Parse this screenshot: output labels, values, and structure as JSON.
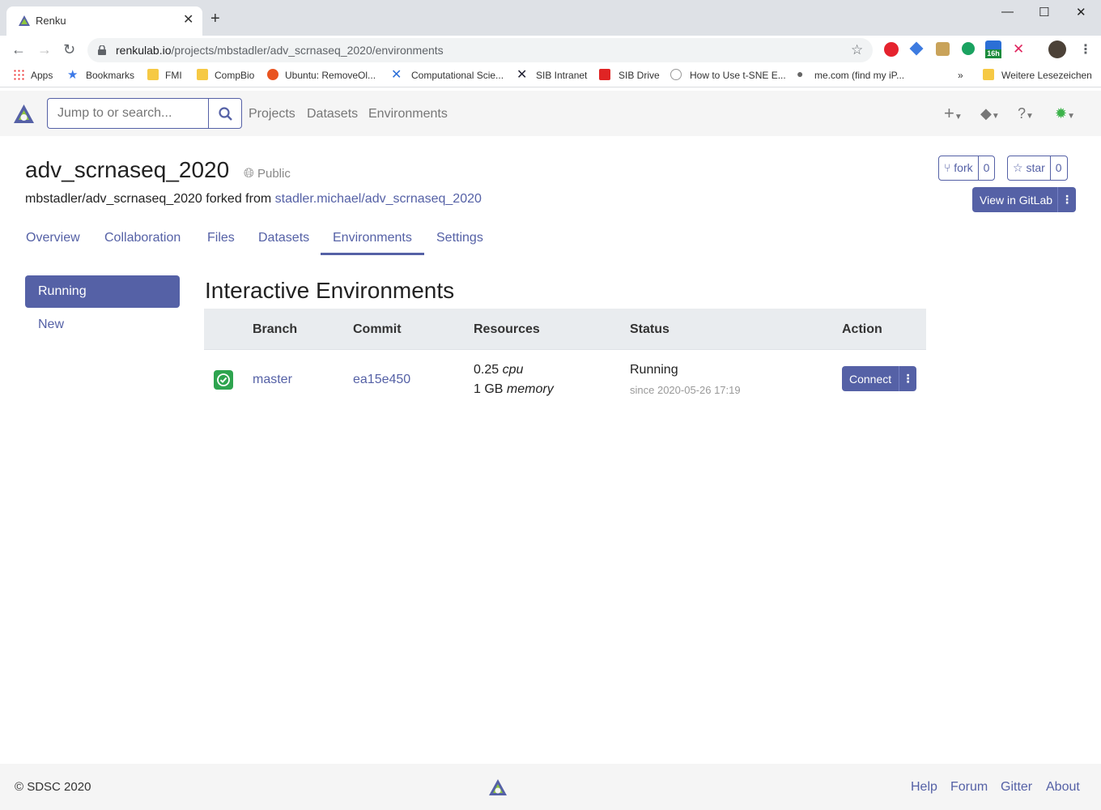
{
  "browser": {
    "tab_title": "Renku",
    "url_host": "renkulab.io",
    "url_path": "/projects/mbstadler/adv_scrnaseq_2020/environments",
    "bookmarks": [
      "Apps",
      "Bookmarks",
      "FMI",
      "CompBio",
      "Ubuntu: RemoveOl...",
      "Computational Scie...",
      "SIB Intranet",
      "SIB Drive",
      "How to Use t-SNE E...",
      "me.com (find my iP...",
      "»",
      "Weitere Lesezeichen"
    ],
    "ext_badge": "16h"
  },
  "app": {
    "search_placeholder": "Jump to or search...",
    "nav": [
      "Projects",
      "Datasets",
      "Environments"
    ],
    "accent": "#5561a6"
  },
  "project": {
    "title": "adv_scrnaseq_2020",
    "visibility": "Public",
    "fork_prefix": "mbstadler/adv_scrnaseq_2020 forked from",
    "fork_source": "stadler.michael/adv_scrnaseq_2020",
    "fork_label": "fork",
    "fork_count": "0",
    "star_label": "star",
    "star_count": "0",
    "gitlab_label": "View in GitLab",
    "tabs": [
      "Overview",
      "Collaboration",
      "Files",
      "Datasets",
      "Environments",
      "Settings"
    ],
    "active_tab": "Environments"
  },
  "sidebar": {
    "running": "Running",
    "new": "New"
  },
  "environments": {
    "heading": "Interactive Environments",
    "columns": [
      "Branch",
      "Commit",
      "Resources",
      "Status",
      "Action"
    ],
    "row": {
      "branch": "master",
      "commit": "ea15e450",
      "cpu_value": "0.25",
      "cpu_unit": "cpu",
      "mem_value": "1 GB",
      "mem_unit": "memory",
      "status": "Running",
      "since": "since 2020-05-26 17:19",
      "action": "Connect"
    }
  },
  "footer": {
    "copyright": "© SDSC 2020",
    "links": [
      "Help",
      "Forum",
      "Gitter",
      "About"
    ]
  }
}
